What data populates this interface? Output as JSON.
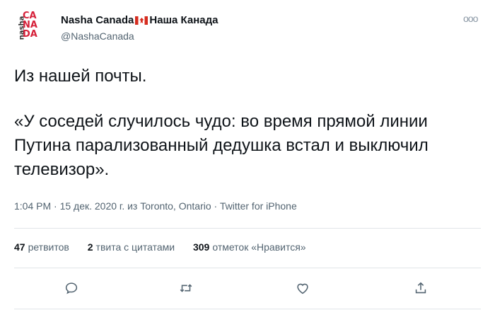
{
  "account": {
    "display_name": "Nasha Canada",
    "display_name_ru": "Наша Канада",
    "handle": "@NashaCanada",
    "avatar_side_text": "nasha",
    "avatar_letters": [
      "CA",
      "NA",
      "DA"
    ],
    "flag": "flag-canada-icon"
  },
  "more_label": "ooo",
  "tweet": {
    "line1": "Из нашей почты.",
    "line2": "«У соседей случилось чудо: во время прямой линии Путина парализованный дедушка встал и выключил телевизор».",
    "timestamp": "1:04 PM · 15 дек. 2020 г. из Toronto, Ontario · Twitter for iPhone"
  },
  "stats": {
    "retweets_count": "47",
    "retweets_label": "ретвитов",
    "quotes_count": "2",
    "quotes_label": "твита с цитатами",
    "likes_count": "309",
    "likes_label": "отметок «Нравится»"
  },
  "actions": [
    "reply-icon",
    "retweet-icon",
    "like-icon",
    "share-icon"
  ],
  "colors": {
    "icon": "#536471",
    "divider": "#e1e5e8",
    "brand_red": "#d6213a"
  }
}
